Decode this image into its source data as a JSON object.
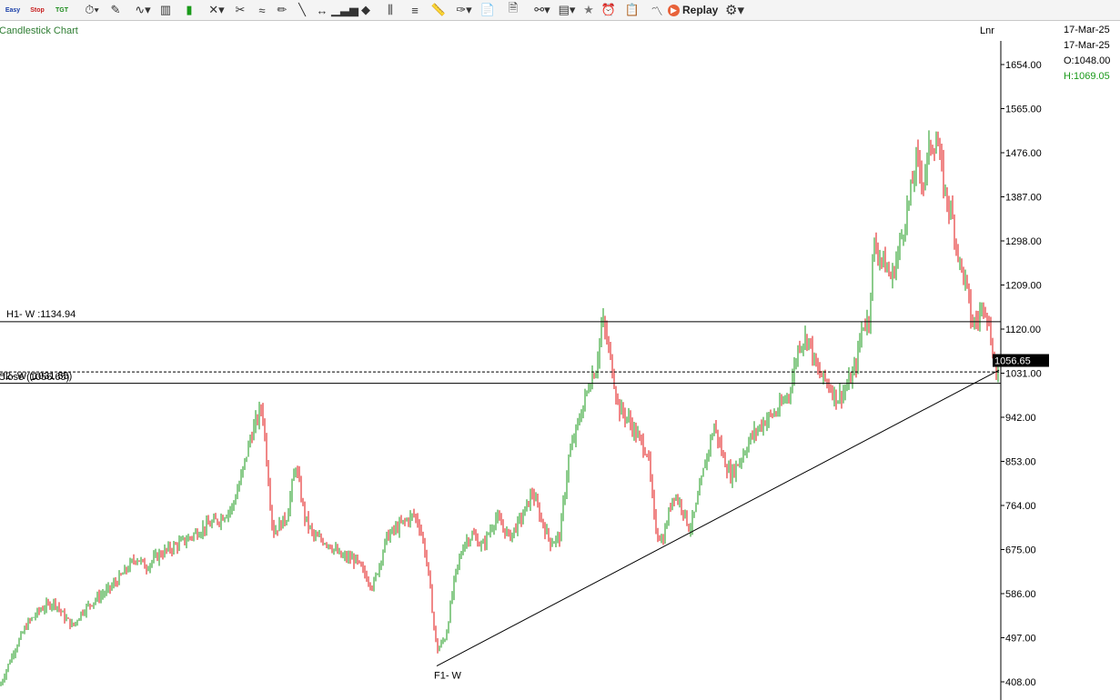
{
  "toolbar": {
    "small_labels": [
      "Easy",
      "Stop",
      "TGT"
    ],
    "icons": [
      "clock-icon",
      "pin-icon",
      "chart-type-icon",
      "bar-chart-icon",
      "candle-icon",
      "cross-icon",
      "scissors-icon",
      "wave-icon",
      "pencil-icon",
      "line-icon",
      "horizontal-line-icon",
      "volume-icon",
      "cube-icon",
      "indicator-icon",
      "equal-icon",
      "ruler-icon",
      "paint-icon",
      "document-icon",
      "notes-icon",
      "link-icon",
      "layout-icon",
      "star-icon",
      "alarm-icon",
      "clipboard-icon",
      "trend-icon"
    ],
    "replay_label": "Replay"
  },
  "chart_header": {
    "title": "Candlestick Chart",
    "scale_mode": "Lnr"
  },
  "info_panel": {
    "date1": "17-Mar-25",
    "date2": "17-Mar-25",
    "open": "O:1048.00",
    "high": "H:1069.05"
  },
  "overlays": {
    "h1_label": "H1- W :1134.94",
    "h2_label": "H2- W (1031.55)",
    "close_label": "Close (1056.65)",
    "trend_label": "F1- W",
    "last_price_label": "1056.65"
  },
  "colors": {
    "up": "#1a9a1a",
    "down": "#e01010",
    "title": "#2e7d32",
    "accent": "#e8623a"
  },
  "chart_data": {
    "type": "candlestick",
    "title": "Candlestick Chart",
    "y_axis_ticks": [
      1654.0,
      1565.0,
      1476.0,
      1387.0,
      1298.0,
      1209.0,
      1120.0,
      1031.0,
      942.0,
      853.0,
      764.0,
      675.0,
      586.0,
      497.0,
      408.0
    ],
    "ylim": [
      390,
      1700
    ],
    "axis_scale": "linear",
    "grid": false,
    "last_close": 1056.65,
    "open": 1048.0,
    "high": 1069.05,
    "horizontal_lines": [
      {
        "name": "H1- W",
        "value": 1134.94,
        "style": "solid"
      },
      {
        "name": "H2- W",
        "value": 1031.55,
        "style": "solid"
      },
      {
        "name": "Close",
        "value": 1056.65,
        "style": "dashed"
      }
    ],
    "trendline": {
      "name": "F1- W",
      "from_price": 440,
      "to_price": 1037
    },
    "price_path_anchors": [
      [
        0,
        400
      ],
      [
        15,
        470
      ],
      [
        30,
        525
      ],
      [
        45,
        555
      ],
      [
        60,
        570
      ],
      [
        70,
        540
      ],
      [
        80,
        520
      ],
      [
        90,
        550
      ],
      [
        105,
        575
      ],
      [
        120,
        595
      ],
      [
        135,
        625
      ],
      [
        150,
        660
      ],
      [
        160,
        640
      ],
      [
        175,
        665
      ],
      [
        190,
        680
      ],
      [
        205,
        695
      ],
      [
        220,
        715
      ],
      [
        240,
        735
      ],
      [
        255,
        760
      ],
      [
        265,
        820
      ],
      [
        275,
        900
      ],
      [
        288,
        965
      ],
      [
        300,
        710
      ],
      [
        315,
        740
      ],
      [
        325,
        845
      ],
      [
        335,
        740
      ],
      [
        345,
        700
      ],
      [
        360,
        690
      ],
      [
        375,
        660
      ],
      [
        390,
        655
      ],
      [
        410,
        600
      ],
      [
        425,
        700
      ],
      [
        440,
        725
      ],
      [
        455,
        745
      ],
      [
        462,
        720
      ],
      [
        470,
        640
      ],
      [
        480,
        470
      ],
      [
        490,
        500
      ],
      [
        500,
        620
      ],
      [
        510,
        690
      ],
      [
        520,
        705
      ],
      [
        530,
        680
      ],
      [
        545,
        740
      ],
      [
        560,
        700
      ],
      [
        575,
        745
      ],
      [
        585,
        790
      ],
      [
        595,
        735
      ],
      [
        605,
        690
      ],
      [
        615,
        700
      ],
      [
        625,
        860
      ],
      [
        640,
        960
      ],
      [
        650,
        1025
      ],
      [
        655,
        1040
      ],
      [
        662,
        1140
      ],
      [
        670,
        1070
      ],
      [
        680,
        960
      ],
      [
        690,
        940
      ],
      [
        700,
        905
      ],
      [
        712,
        870
      ],
      [
        720,
        720
      ],
      [
        728,
        690
      ],
      [
        740,
        790
      ],
      [
        750,
        760
      ],
      [
        758,
        715
      ],
      [
        765,
        760
      ],
      [
        775,
        850
      ],
      [
        785,
        925
      ],
      [
        795,
        860
      ],
      [
        803,
        825
      ],
      [
        813,
        855
      ],
      [
        825,
        900
      ],
      [
        840,
        935
      ],
      [
        855,
        955
      ],
      [
        868,
        995
      ],
      [
        878,
        1090
      ],
      [
        888,
        1105
      ],
      [
        898,
        1035
      ],
      [
        910,
        1010
      ],
      [
        920,
        980
      ],
      [
        930,
        1000
      ],
      [
        940,
        1040
      ],
      [
        948,
        1130
      ],
      [
        955,
        1140
      ],
      [
        960,
        1290
      ],
      [
        970,
        1260
      ],
      [
        980,
        1220
      ],
      [
        990,
        1300
      ],
      [
        1000,
        1385
      ],
      [
        1007,
        1460
      ],
      [
        1015,
        1420
      ],
      [
        1022,
        1490
      ],
      [
        1030,
        1500
      ],
      [
        1038,
        1400
      ],
      [
        1046,
        1350
      ],
      [
        1055,
        1250
      ],
      [
        1062,
        1210
      ],
      [
        1068,
        1130
      ],
      [
        1075,
        1140
      ],
      [
        1082,
        1180
      ],
      [
        1090,
        1090
      ],
      [
        1095,
        1030
      ],
      [
        1099,
        1057
      ]
    ]
  }
}
